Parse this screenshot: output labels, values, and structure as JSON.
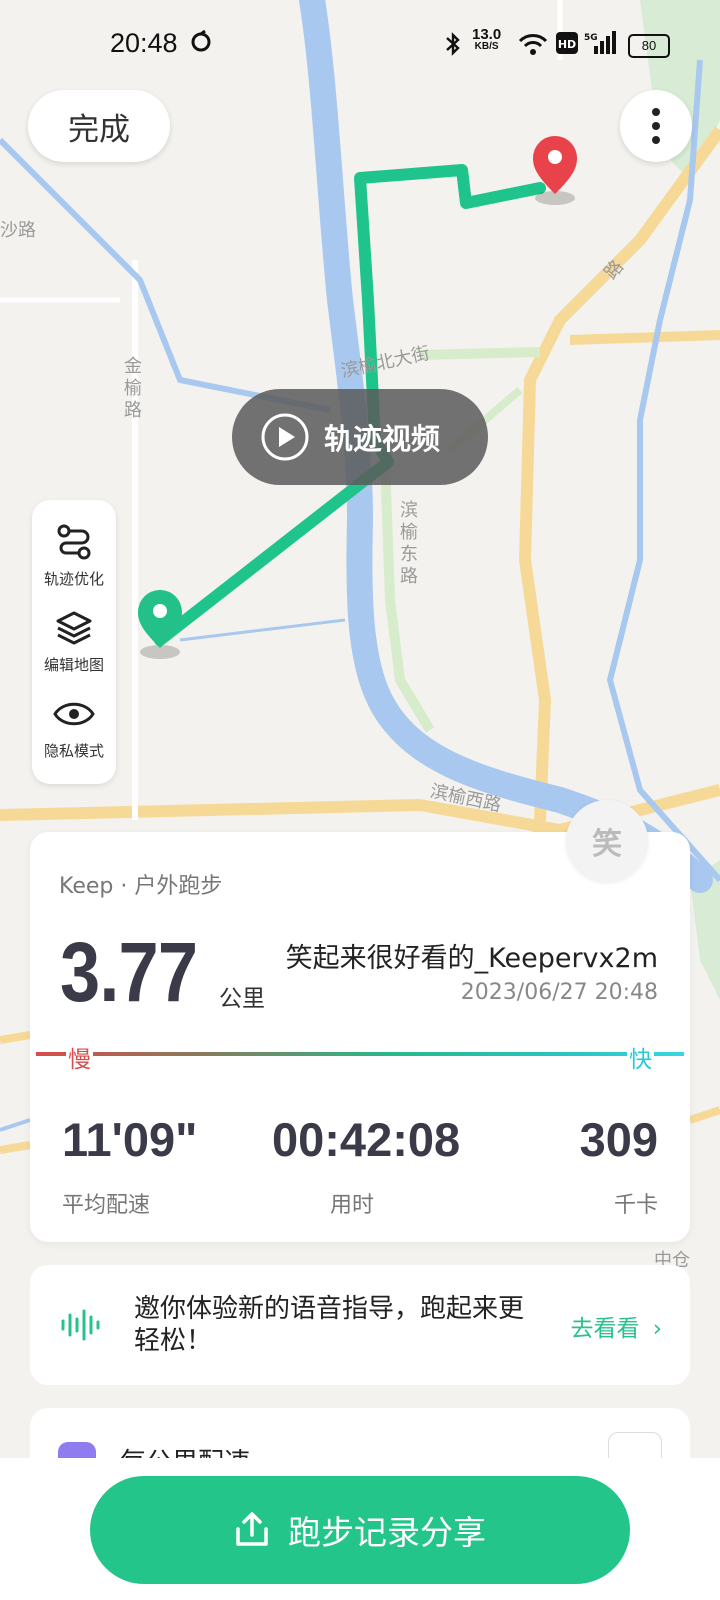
{
  "status_bar": {
    "time": "20:48",
    "net_speed_value": "13.0",
    "net_speed_unit": "KB/S",
    "network": "5G",
    "battery": "80"
  },
  "header": {
    "done_label": "完成"
  },
  "map": {
    "video_label": "轨迹视频",
    "street_labels": [
      "沙路",
      "金榆路",
      "滨榆北大街",
      "滨榆东路",
      "滨榆西路",
      "路",
      "中仓"
    ],
    "route_color": "#1fc48c",
    "start_color": "#23c08a",
    "end_color": "#e8424a"
  },
  "tools": [
    {
      "label": "轨迹优化",
      "icon": "route-optimize-icon"
    },
    {
      "label": "编辑地图",
      "icon": "layers-icon"
    },
    {
      "label": "隐私模式",
      "icon": "eye-icon"
    }
  ],
  "summary": {
    "source": "Keep · 户外跑步",
    "distance": "3.77",
    "distance_unit": "公里",
    "username": "笑起来很好看的_Keepervx2m",
    "datetime": "2023/06/27 20:48",
    "slow_label": "慢",
    "fast_label": "快",
    "avatar_text": "笑",
    "metrics": [
      {
        "value": "11'09\"",
        "label": "平均配速"
      },
      {
        "value": "00:42:08",
        "label": "用时"
      },
      {
        "value": "309",
        "label": "千卡"
      }
    ]
  },
  "voice_banner": {
    "text": "邀你体验新的语音指导，跑起来更轻松！",
    "action": "去看看"
  },
  "next_section": {
    "label": "每公里配速"
  },
  "share": {
    "label": "跑步记录分享"
  }
}
